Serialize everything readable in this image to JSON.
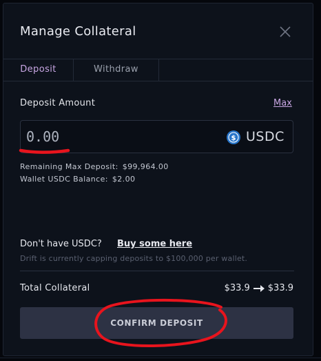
{
  "modal": {
    "title": "Manage Collateral",
    "tabs": [
      {
        "label": "Deposit",
        "active": true
      },
      {
        "label": "Withdraw",
        "active": false
      }
    ]
  },
  "deposit": {
    "amount_label": "Deposit Amount",
    "max_label": "Max",
    "amount_placeholder": "0.00",
    "amount_value": "",
    "token_symbol": "USDC",
    "remaining_label": "Remaining Max Deposit:",
    "remaining_value": "$99,964.00",
    "balance_label": "Wallet USDC Balance:",
    "balance_value": "$2.00"
  },
  "help": {
    "question": "Don't have USDC?",
    "buy_link": "Buy some here",
    "cap_note": "Drift is currently capping deposits to $100,000 per wallet."
  },
  "summary": {
    "total_label": "Total Collateral",
    "from_value": "$33.9",
    "to_value": "$33.9"
  },
  "actions": {
    "confirm_label": "CONFIRM DEPOSIT"
  },
  "colors": {
    "accent": "#c8a6e3",
    "background": "#0d121b",
    "annotation": "#e8141d",
    "usdc_blue": "#2775ca"
  },
  "icons": [
    "close-icon",
    "usdc-icon",
    "arrow-right-icon"
  ]
}
